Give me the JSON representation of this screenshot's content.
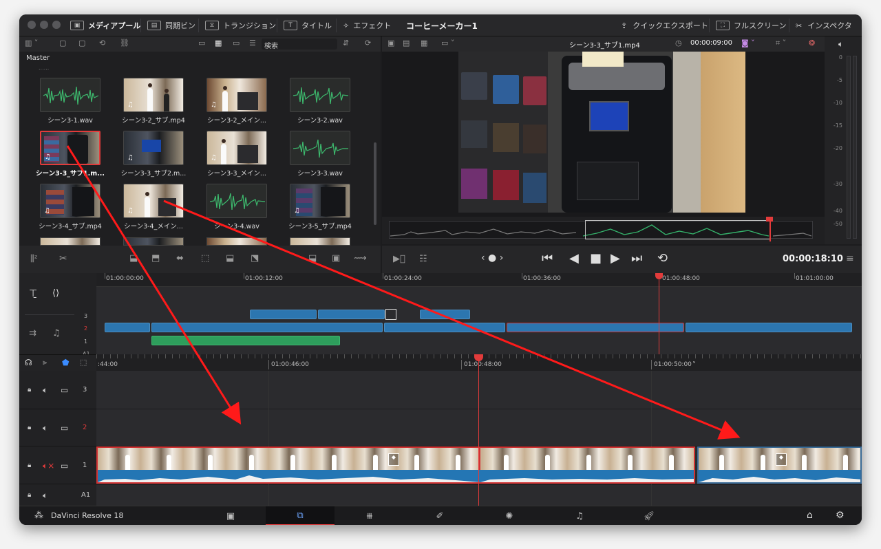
{
  "app": {
    "name": "DaVinci Resolve 18",
    "project_title": "コーヒーメーカー1"
  },
  "top_menu": {
    "media_pool": "メディアプール",
    "sync_bin": "同期ビン",
    "transitions": "トランジション",
    "titles": "タイトル",
    "effects": "エフェクト",
    "quick_export": "クイックエクスポート",
    "fullscreen": "フルスクリーン",
    "inspector": "インスペクタ"
  },
  "media_pool": {
    "search_placeholder": "検索",
    "bin_name": "Master",
    "clips": [
      {
        "name": "シーン3-1.wav",
        "kind": "audio"
      },
      {
        "name": "シーン3-2_サブ.mp4",
        "kind": "video"
      },
      {
        "name": "シーン3-2_メイン...",
        "kind": "video"
      },
      {
        "name": "シーン3-2.wav",
        "kind": "audio"
      },
      {
        "name": "シーン3-3_サブ1.m...",
        "kind": "video",
        "selected": true
      },
      {
        "name": "シーン3-3_サブ2.m...",
        "kind": "video"
      },
      {
        "name": "シーン3-3_メイン...",
        "kind": "video"
      },
      {
        "name": "シーン3-3.wav",
        "kind": "audio"
      },
      {
        "name": "シーン3-4_サブ.mp4",
        "kind": "video"
      },
      {
        "name": "シーン3-4_メイン...",
        "kind": "video"
      },
      {
        "name": "シーン3-4.wav",
        "kind": "audio"
      },
      {
        "name": "シーン3-5_サブ.mp4",
        "kind": "video"
      }
    ]
  },
  "viewer": {
    "clip_name": "シーン3-3_サブ1.mp4",
    "clip_timecode": "00:00:09:00",
    "playhead_timecode": "00:00:18:10"
  },
  "audio_meter": {
    "ticks": [
      "0",
      "-5",
      "-10",
      "-15",
      "-20",
      "-30",
      "-40",
      "-50"
    ]
  },
  "upper_timeline": {
    "ruler": [
      "01:00:00:00",
      "01:00:12:00",
      "01:00:24:00",
      "01:00:36:00",
      "01:00:48:00",
      "01:01:00:00"
    ],
    "tracks": [
      "3",
      "2",
      "1",
      "A1"
    ]
  },
  "lower_timeline": {
    "ruler": [
      ":44:00",
      "01:00:46:00",
      "01:00:48:00",
      "01:00:50:00"
    ],
    "tracks": [
      "3",
      "2",
      "1",
      "A1"
    ]
  },
  "pages": [
    "media",
    "cut",
    "edit",
    "fusion",
    "color",
    "fairlight",
    "deliver"
  ],
  "colors": {
    "accent": "#e23b3b",
    "clip_blue": "#2c76b0",
    "audio_green": "#2e9e5c",
    "playhead": "#e23b3b"
  }
}
